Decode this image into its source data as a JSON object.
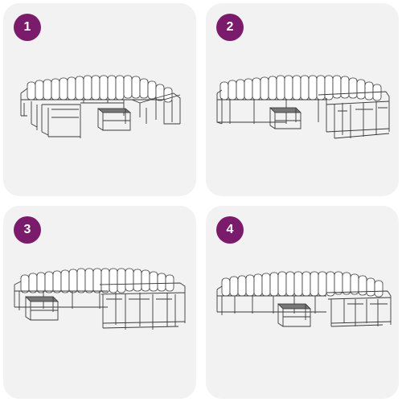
{
  "panels": [
    {
      "number": "1",
      "accent": "#7a1b6b",
      "icon": "sofa-layout-illustration"
    },
    {
      "number": "2",
      "accent": "#7a1b6b",
      "icon": "sofa-layout-illustration"
    },
    {
      "number": "3",
      "accent": "#7a1b6b",
      "icon": "sofa-layout-illustration"
    },
    {
      "number": "4",
      "accent": "#7a1b6b",
      "icon": "sofa-layout-illustration"
    }
  ],
  "colors": {
    "background": "#ffffff",
    "panel": "#f2f2f2",
    "badge": "#7a1b6b",
    "badge_text": "#ffffff",
    "table_top": "#777777"
  }
}
